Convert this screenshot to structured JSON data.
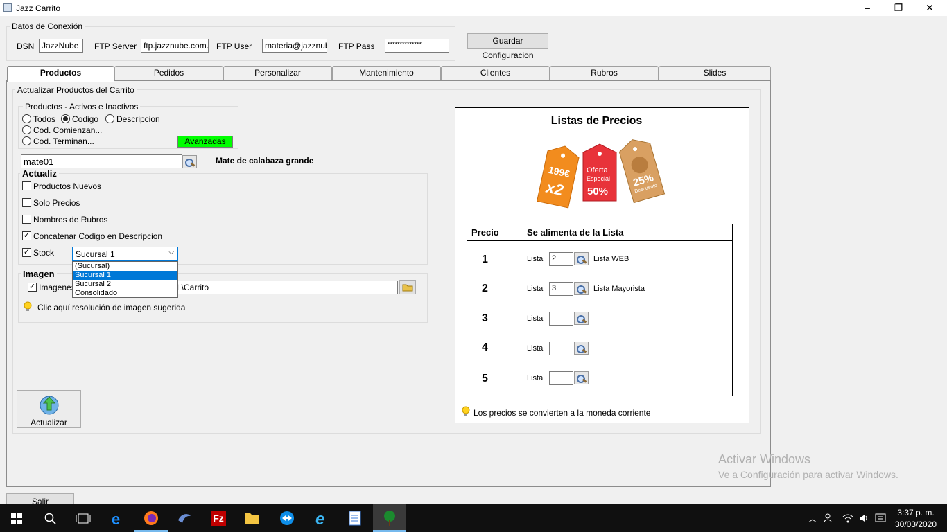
{
  "window": {
    "title": "Jazz Carrito",
    "minimize": "–",
    "maximize": "❐",
    "close": "✕"
  },
  "connection": {
    "group_title": "Datos de Conexión",
    "dsn_label": "DSN",
    "dsn_value": "JazzNube",
    "ftp_server_label": "FTP Server",
    "ftp_server_value": "ftp.jazznube.com.ar",
    "ftp_user_label": "FTP User",
    "ftp_user_value": "materia@jazznube",
    "ftp_pass_label": "FTP Pass",
    "ftp_pass_value": "**************",
    "save_button": "Guardar Configuracion"
  },
  "tabs": [
    "Productos",
    "Pedidos",
    "Personalizar",
    "Mantenimiento",
    "Clientes",
    "Rubros",
    "Slides"
  ],
  "productos": {
    "section_title": "Actualizar Productos del Carrito",
    "filter_group": "Productos - Activos e Inactivos",
    "radio_todos": "Todos",
    "radio_codigo": "Codigo",
    "radio_descripcion": "Descripcion",
    "radio_comienzan": "Cod. Comienzan...",
    "radio_terminan": "Cod. Terminan...",
    "avanzadas": "Avanzadas",
    "code_value": "mate01",
    "product_name": "Mate de calabaza grande",
    "actualiz_group": "Actualiz",
    "chk_nuevos": "Productos Nuevos",
    "chk_precios": "Solo Precios",
    "chk_rubros": "Nombres de Rubros",
    "chk_concatenar": "Concatenar Codigo en Descripcion",
    "chk_stock": "Stock",
    "stock_selected": "Sucursal 1",
    "stock_options": [
      "(Sucursal)",
      "Sucursal 1",
      "Sucursal 2",
      "Consolidado"
    ],
    "imagen_group": "Imagen",
    "chk_imagenes": "Imagenes",
    "image_path": "L\\Carrito",
    "tip_image": "Clic aquí resolución de imagen sugerida",
    "actualizar_button": "Actualizar",
    "salir_button": "Salir"
  },
  "price_lists": {
    "title": "Listas de Precios",
    "tag1_top": "199€",
    "tag1_bottom": "x2",
    "tag2_top": "Oferta",
    "tag2_mid": "Especial",
    "tag2_bottom": "50%",
    "tag3_top": "25%",
    "tag3_bottom": "Descuento",
    "col_precio": "Precio",
    "col_lista": "Se alimenta de la Lista",
    "rows": [
      {
        "num": "1",
        "label": "Lista",
        "value": "2",
        "name": "Lista WEB"
      },
      {
        "num": "2",
        "label": "Lista",
        "value": "3",
        "name": "Lista Mayorista"
      },
      {
        "num": "3",
        "label": "Lista",
        "value": "",
        "name": ""
      },
      {
        "num": "4",
        "label": "Lista",
        "value": "",
        "name": ""
      },
      {
        "num": "5",
        "label": "Lista",
        "value": "",
        "name": ""
      }
    ],
    "tip": "Los precios se convierten a la moneda corriente"
  },
  "watermark": {
    "line1": "Activar Windows",
    "line2": "Ve a Configuración para activar Windows."
  },
  "taskbar": {
    "time": "3:37 p. m.",
    "date": "30/03/2020"
  }
}
